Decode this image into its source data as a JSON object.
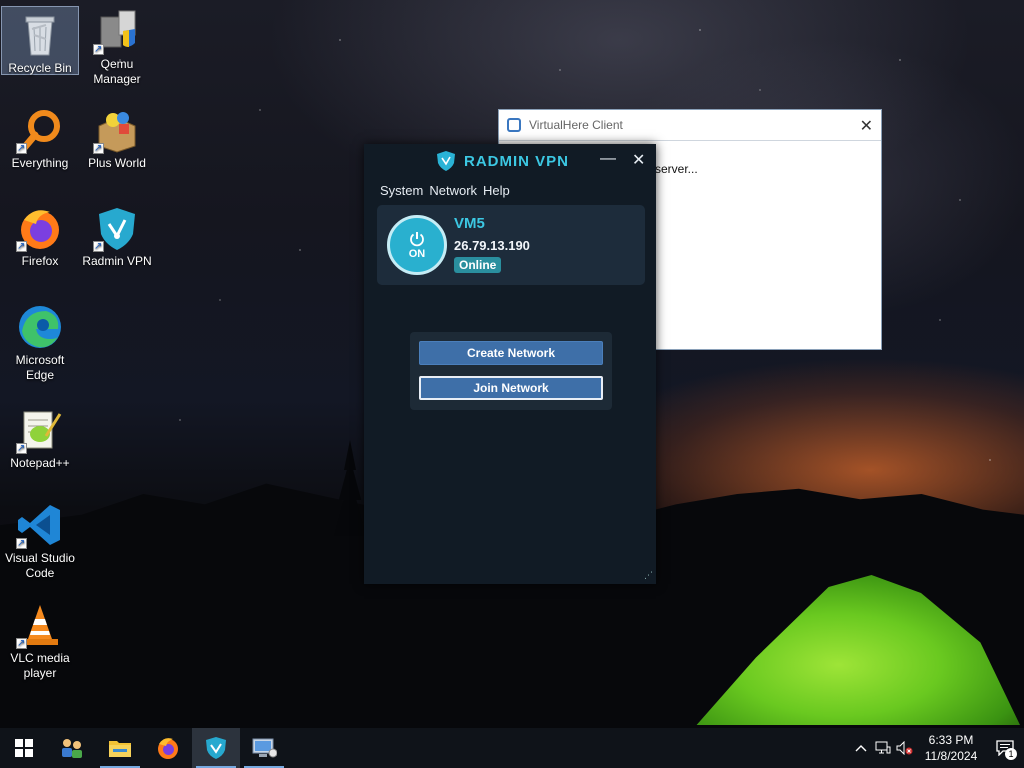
{
  "desktop": {
    "icons": [
      {
        "label": "Recycle Bin"
      },
      {
        "label": "Qemu Manager"
      },
      {
        "label": "Everything"
      },
      {
        "label": "Plus World"
      },
      {
        "label": "Firefox"
      },
      {
        "label": "Radmin VPN"
      },
      {
        "label": "Microsoft Edge"
      },
      {
        "label": "Notepad++"
      },
      {
        "label": "Visual Studio Code"
      },
      {
        "label": "VLC media player"
      }
    ]
  },
  "virtualhere": {
    "title": "VirtualHere Client",
    "close": "✕",
    "body_text": "server..."
  },
  "radmin": {
    "logo_text": "RADMIN VPN",
    "minimize": "—",
    "close": "✕",
    "menu": [
      "System",
      "Network",
      "Help"
    ],
    "vm_name": "VM5",
    "ip": "26.79.13.190",
    "status": "Online",
    "power_label": "ON",
    "create_network": "Create Network",
    "join_network": "Join Network",
    "accent_color": "#3cc8e3"
  },
  "taskbar": {
    "items": [
      "start-icon",
      "network-people-icon",
      "file-explorer-icon",
      "firefox-icon",
      "radmin-vpn-icon",
      "remote-desktop-icon"
    ],
    "clock_time": "6:33 PM",
    "clock_date": "11/8/2024",
    "notification_count": "1"
  }
}
